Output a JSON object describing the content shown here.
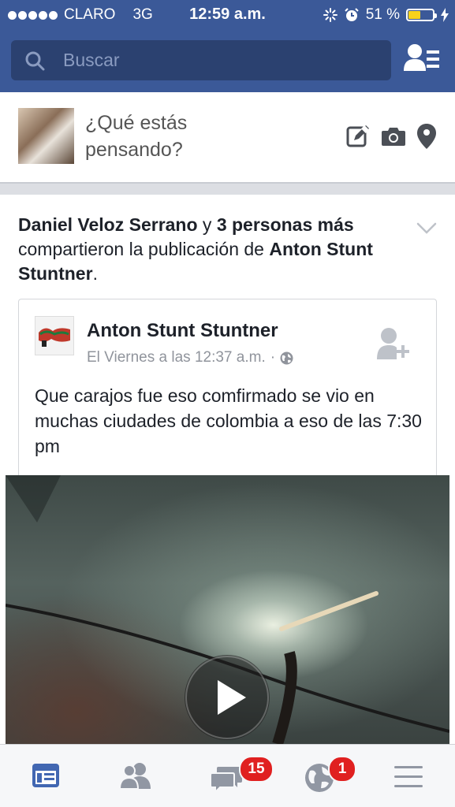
{
  "status_bar": {
    "carrier": "CLARO",
    "network": "3G",
    "time": "12:59 a.m.",
    "battery_text": "51 %",
    "battery_level": 0.51
  },
  "search": {
    "placeholder": "Buscar"
  },
  "composer": {
    "prompt": "¿Qué estás pensando?"
  },
  "post": {
    "sharer": "Daniel Veloz Serrano",
    "conj": " y ",
    "others": "3 personas más",
    "action": " compartieron la publicación de ",
    "original_author": "Anton Stunt Stuntner",
    "period": ".",
    "page_name": "Anton Stunt Stuntner",
    "timestamp": "El Viernes a las 12:37 a.m.",
    "separator": "·",
    "body": "Que carajos fue eso comfirmado se vio en muchas ciudades de colombia a eso de las 7:30 pm"
  },
  "tabbar": {
    "messages_badge": "15",
    "notifications_badge": "1"
  },
  "colors": {
    "brand": "#3b5998",
    "active_tab": "#4267b2",
    "inactive_tab": "#9197a3",
    "badge": "#e02020"
  }
}
